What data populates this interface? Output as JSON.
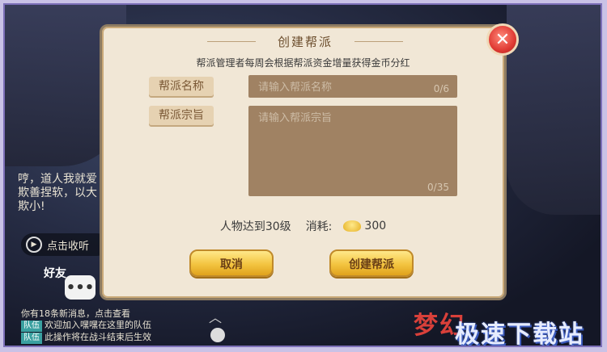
{
  "dialog": {
    "title": "创建帮派",
    "subtitle": "帮派管理者每周会根据帮派资金增量获得金币分红",
    "name_label": "帮派名称",
    "name_placeholder": "请输入帮派名称",
    "name_count": "0/6",
    "purpose_label": "帮派宗旨",
    "purpose_placeholder": "请输入帮派宗旨",
    "purpose_count": "0/35",
    "requirement": "人物达到30级",
    "cost_label": "消耗:",
    "cost_value": "300",
    "cancel_label": "取消",
    "create_label": "创建帮派",
    "close_glyph": "✕"
  },
  "background": {
    "chat_lines": [
      "哼，道人我就爱",
      "欺善捏软，以大",
      "欺小!"
    ],
    "listen_label": "点击收听",
    "friend_label": "好友",
    "bottom_chat": [
      {
        "tag": "",
        "text": "你有18条新消息，点击查看"
      },
      {
        "tag": "队伍",
        "text": "欢迎加入嘿嘿在这里的队伍"
      },
      {
        "tag": "队伍",
        "text": "此操作将在战斗结束后生效"
      }
    ],
    "game_logo": "梦幻",
    "watermark": "极速下载站"
  },
  "colors": {
    "dialog_bg": "#f1e7d6",
    "field_bg": "#a08263",
    "button_gold": "#f3c440",
    "close_red": "#e03b34"
  }
}
